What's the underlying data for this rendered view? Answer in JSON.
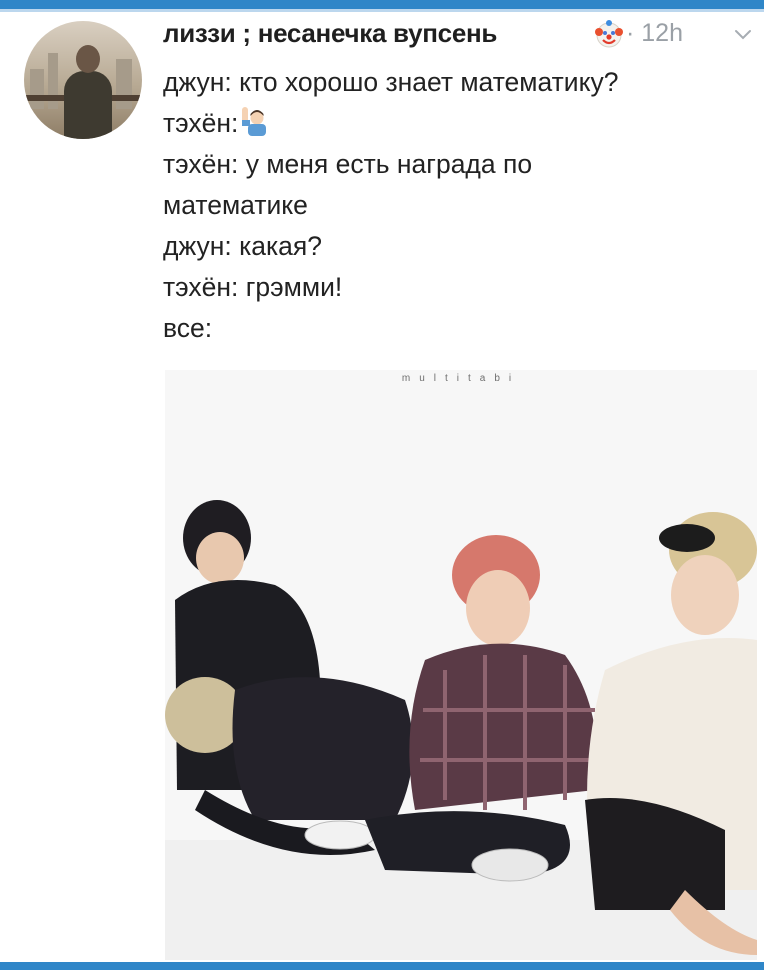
{
  "tweet": {
    "author": "лиззи ; несанечка вупсень",
    "separator": "·",
    "time": "12h",
    "lines": [
      "джун: кто хорошо знает математику?",
      "тэхён:",
      "тэхён: у меня есть награда по",
      "математике",
      "джун: какая?",
      "тэхён: грэмми!",
      "все:"
    ],
    "icons": {
      "author_badge": "clown-face-emoji",
      "raised_hand": "man-raising-hand-emoji",
      "menu": "chevron-down-icon"
    }
  },
  "media": {
    "watermark": "multitabi",
    "background": "#f7f7f7"
  },
  "colors": {
    "accent": "#2f86c8",
    "text": "#222222",
    "muted": "#9aa0a6"
  }
}
